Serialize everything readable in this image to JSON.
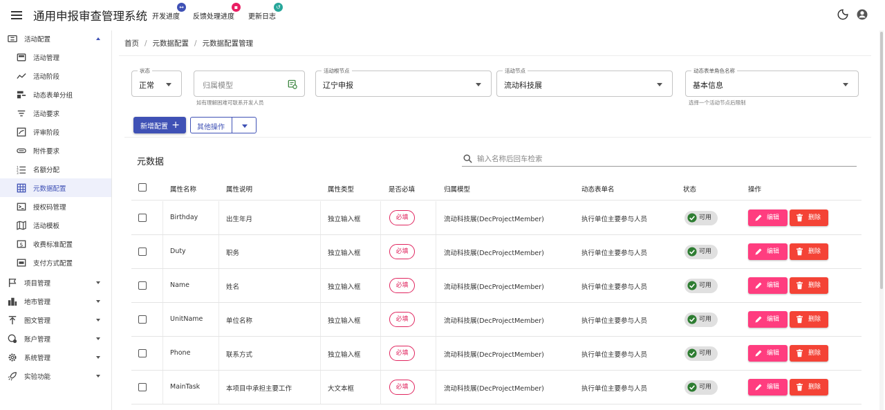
{
  "app": {
    "title": "通用申报审查管理系统",
    "nav_links": [
      {
        "label": "开发进度",
        "badge_icon": "sync-icon",
        "badge_color": "#3f51b5"
      },
      {
        "label": "反馈处理进度",
        "badge_icon": "chat-icon",
        "badge_color": "#e91e63"
      },
      {
        "label": "更新日志",
        "badge_icon": "history-icon",
        "badge_color": "#26a69a"
      }
    ]
  },
  "sidebar": {
    "groups": [
      {
        "label": "活动配置",
        "icon": "ticket-icon",
        "expanded": true
      },
      {
        "label": "项目管理",
        "icon": "flag-icon",
        "expanded": false
      },
      {
        "label": "地市管理",
        "icon": "city-icon",
        "expanded": false
      },
      {
        "label": "图文管理",
        "icon": "upload-icon",
        "expanded": false
      },
      {
        "label": "账户管理",
        "icon": "account-icon",
        "expanded": false
      },
      {
        "label": "系统管理",
        "icon": "gear-icon",
        "expanded": false
      },
      {
        "label": "实验功能",
        "icon": "rocket-icon",
        "expanded": false
      }
    ],
    "items": [
      {
        "label": "活动管理",
        "icon": "window-icon"
      },
      {
        "label": "活动阶段",
        "icon": "trend-icon"
      },
      {
        "label": "动态表单分组",
        "icon": "form-group-icon"
      },
      {
        "label": "活动要求",
        "icon": "filter-icon"
      },
      {
        "label": "评审阶段",
        "icon": "review-icon"
      },
      {
        "label": "附件要求",
        "icon": "attachment-icon"
      },
      {
        "label": "名额分配",
        "icon": "list-icon"
      },
      {
        "label": "元数据配置",
        "icon": "grid-icon",
        "active": true
      },
      {
        "label": "授权码管理",
        "icon": "terminal-icon"
      },
      {
        "label": "活动模板",
        "icon": "map-icon"
      },
      {
        "label": "收费标准配置",
        "icon": "money-icon"
      },
      {
        "label": "支付方式配置",
        "icon": "payment-icon"
      }
    ]
  },
  "breadcrumb": [
    "首页",
    "元数据配置",
    "元数据配置管理"
  ],
  "filters": {
    "status": {
      "label": "状态",
      "value": "正常"
    },
    "model": {
      "placeholder": "归属模型",
      "helper": "如有理解困难可联系开发人员"
    },
    "root_node": {
      "label": "活动根节点",
      "value": "辽宁申报"
    },
    "node": {
      "label": "活动节点",
      "value": "流动科技展"
    },
    "role": {
      "label": "动态表单角色名称",
      "value": "基本信息",
      "helper": "选择一个活动节点后限制"
    }
  },
  "actions": {
    "add_label": "新增配置",
    "other_label": "其他操作"
  },
  "table": {
    "title": "元数据",
    "search_placeholder": "输入名称后回车检索",
    "headers": [
      "属性名称",
      "属性说明",
      "属性类型",
      "是否必填",
      "归属模型",
      "动态表单名",
      "状态",
      "操作"
    ],
    "rows": [
      {
        "name": "Birthday",
        "desc": "出生年月",
        "type": "独立输入框",
        "required": "必填",
        "model": "流动科技展(DecProjectMember)",
        "form": "执行单位主要参与人员",
        "status": "可用"
      },
      {
        "name": "Duty",
        "desc": "职务",
        "type": "独立输入框",
        "required": "必填",
        "model": "流动科技展(DecProjectMember)",
        "form": "执行单位主要参与人员",
        "status": "可用"
      },
      {
        "name": "Name",
        "desc": "姓名",
        "type": "独立输入框",
        "required": "必填",
        "model": "流动科技展(DecProjectMember)",
        "form": "执行单位主要参与人员",
        "status": "可用"
      },
      {
        "name": "UnitName",
        "desc": "单位名称",
        "type": "独立输入框",
        "required": "必填",
        "model": "流动科技展(DecProjectMember)",
        "form": "执行单位主要参与人员",
        "status": "可用"
      },
      {
        "name": "Phone",
        "desc": "联系方式",
        "type": "独立输入框",
        "required": "必填",
        "model": "流动科技展(DecProjectMember)",
        "form": "执行单位主要参与人员",
        "status": "可用"
      },
      {
        "name": "MainTask",
        "desc": "本项目中承担主要工作",
        "type": "大文本框",
        "required": "必填",
        "model": "流动科技展(DecProjectMember)",
        "form": "执行单位主要参与人员",
        "status": "可用"
      }
    ],
    "edit_label": "编辑",
    "delete_label": "删除"
  }
}
